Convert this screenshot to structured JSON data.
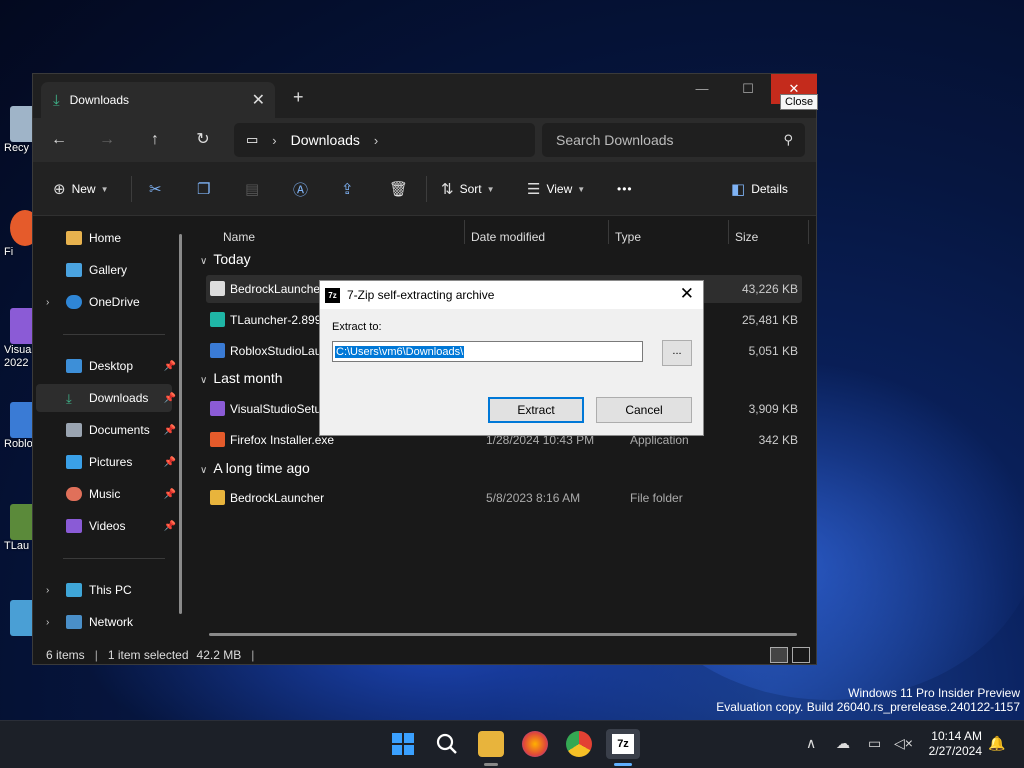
{
  "desktop": {
    "icons": [
      {
        "label": "Recy",
        "color": "#9fb4c8"
      },
      {
        "label": "Fi",
        "color": "#e55b2b"
      },
      {
        "label": "Visua\n2022",
        "color": "#8b5bd6"
      },
      {
        "label": "Roblo",
        "color": "#3a7bd5"
      },
      {
        "label": "TLau",
        "color": "#5b8a3a"
      },
      {
        "label": "",
        "color": "#4a9fd5"
      }
    ]
  },
  "explorer": {
    "tab_title": "Downloads",
    "tab_close": "✕",
    "new_tab": "+",
    "tooltip": "Close",
    "address": {
      "crumb": "Downloads"
    },
    "search_placeholder": "Search Downloads",
    "commands": {
      "new": "New",
      "sort": "Sort",
      "view": "View",
      "more": "•••",
      "details": "Details"
    },
    "sidebar": {
      "home": "Home",
      "gallery": "Gallery",
      "onedrive": "OneDrive",
      "desktop": "Desktop",
      "downloads": "Downloads",
      "documents": "Documents",
      "pictures": "Pictures",
      "music": "Music",
      "videos": "Videos",
      "thispc": "This PC",
      "network": "Network"
    },
    "columns": {
      "name": "Name",
      "date": "Date modified",
      "type": "Type",
      "size": "Size"
    },
    "groups": {
      "today": "Today",
      "last_month": "Last month",
      "long_ago": "A long time ago"
    },
    "files": [
      {
        "name": "BedrockLauncher",
        "date": "",
        "type": "",
        "size": "43,226 KB"
      },
      {
        "name": "TLauncher-2.899",
        "date": "",
        "type": "",
        "size": "25,481 KB"
      },
      {
        "name": "RobloxStudioLau",
        "date": "",
        "type": "",
        "size": "5,051 KB"
      },
      {
        "name": "VisualStudioSetu",
        "date": "",
        "type": "",
        "size": "3,909 KB"
      },
      {
        "name": "Firefox Installer.exe",
        "date": "1/28/2024 10:43 PM",
        "type": "Application",
        "size": "342 KB"
      },
      {
        "name": "BedrockLauncher",
        "date": "5/8/2023 8:16 AM",
        "type": "File folder",
        "size": ""
      }
    ],
    "status": {
      "items": "6 items",
      "selected": "1 item selected",
      "size": "42.2 MB"
    }
  },
  "dialog": {
    "title": "7-Zip self-extracting archive",
    "icon_text": "7z",
    "label": "Extract to:",
    "path": "C:\\Users\\vm6\\Downloads\\",
    "browse": "...",
    "extract": "Extract",
    "cancel": "Cancel"
  },
  "watermark": {
    "line1": "Windows 11 Pro Insider Preview",
    "line2": "Evaluation copy. Build 26040.rs_prerelease.240122-1157"
  },
  "clock": {
    "time": "10:14 AM",
    "date": "2/27/2024"
  },
  "colors": {
    "accent": "#0078d7",
    "close_red": "#c42b1c"
  }
}
